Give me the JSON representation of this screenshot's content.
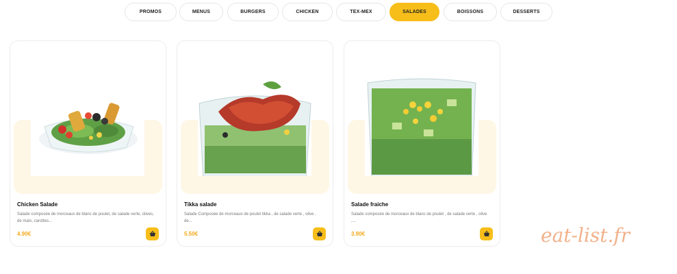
{
  "tabs": [
    {
      "label": "PROMOS"
    },
    {
      "label": "MENUS"
    },
    {
      "label": "BURGERS"
    },
    {
      "label": "CHICKEN"
    },
    {
      "label": "TEX-MEX"
    },
    {
      "label": "SALADES",
      "active": true
    },
    {
      "label": "BOISSONS"
    },
    {
      "label": "DESSERTS"
    }
  ],
  "products": [
    {
      "name": "Chicken Salade",
      "description": "Salade composée de morceaux de blanc de poulet, de salade verte, olives, de maïs, carottes...",
      "price": "4.90€"
    },
    {
      "name": "Tikka salade",
      "description": "Salade Composée de morceaux de poulet tikka , de salade verte , olive , de...",
      "price": "5.50€"
    },
    {
      "name": "Salade fraiche",
      "description": "Salade composée de morceaux de blanc de poulet , de salade verte , olive ,...",
      "price": "3.90€"
    }
  ],
  "watermark": "eat-list.fr",
  "colors": {
    "accent": "#f7be1a",
    "price": "#f2a818",
    "band": "#fff7e6"
  }
}
